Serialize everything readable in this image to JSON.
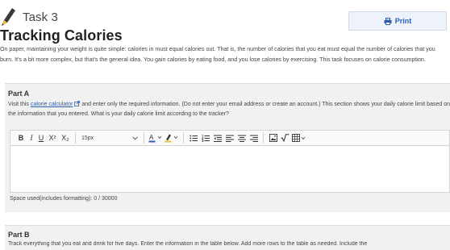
{
  "task": {
    "label": "Task 3"
  },
  "print": {
    "label": "Print"
  },
  "title": "Tracking Calories",
  "intro": "On paper, maintaining your weight is quite simple: calories in must equal calories out. That is, the number of calories that you eat must equal the number of calories that you burn. It's a bit more complex, but that's the general idea. You gain calories by eating food, and you lose calories by exercising. This task focuses on calorie consumption.",
  "partA": {
    "label": "Part A",
    "text_before": "Visit this ",
    "link": "calorie calculator",
    "text_after": " and enter only the required information. (Do not enter your email address or create an account.) This section shows your daily calorie limit based on the information that you entered. What is your daily calorie limit according to the tracker?",
    "toolbar": {
      "bold": "B",
      "italic": "I",
      "underline": "U",
      "superscript": "X²",
      "subscript": "X₂",
      "font_size": "15px"
    },
    "space_used": "Space used(includes formatting): 0 / 30000"
  },
  "partB": {
    "label": "Part B",
    "text": "Track everything that you eat and drink for five days. Enter the information in the table below. Add more rows to the table as needed. Include the"
  },
  "colors": {
    "accent": "#2b5fad",
    "pencil": "#3a3a3a",
    "pencil_tip": "#e8c341"
  }
}
